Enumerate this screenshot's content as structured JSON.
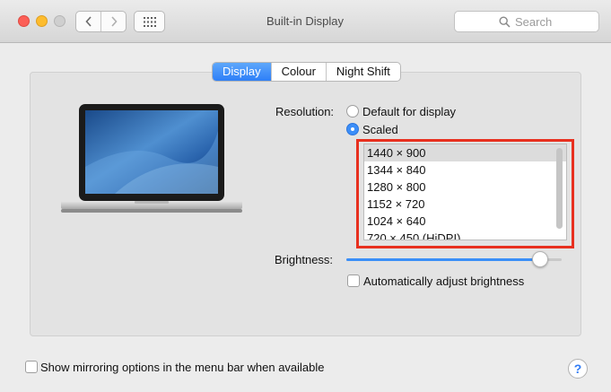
{
  "window": {
    "title": "Built-in Display"
  },
  "toolbar": {
    "back_icon": "chevron-left-icon",
    "forward_icon": "chevron-right-icon",
    "grid_icon": "grid-icon"
  },
  "search": {
    "placeholder": "Search",
    "value": ""
  },
  "tabs": [
    {
      "label": "Display",
      "active": true
    },
    {
      "label": "Colour",
      "active": false
    },
    {
      "label": "Night Shift",
      "active": false
    }
  ],
  "resolution": {
    "label": "Resolution:",
    "options": [
      {
        "label": "Default for display",
        "selected": false
      },
      {
        "label": "Scaled",
        "selected": true
      }
    ],
    "scaled_list": [
      {
        "label": "1440 × 900",
        "selected": true
      },
      {
        "label": "1344 × 840",
        "selected": false
      },
      {
        "label": "1280 × 800",
        "selected": false
      },
      {
        "label": "1152 × 720",
        "selected": false
      },
      {
        "label": "1024 × 640",
        "selected": false
      },
      {
        "label": "720 × 450 (HiDPI)",
        "selected": false
      }
    ]
  },
  "brightness": {
    "label": "Brightness:",
    "level": 0.9,
    "auto_label": "Automatically adjust brightness",
    "auto_checked": false
  },
  "mirroring": {
    "label": "Show mirroring options in the menu bar when available",
    "checked": false
  },
  "help": {
    "label": "?"
  },
  "colors": {
    "accent": "#3b8ff7",
    "highlight_border": "#e8301f"
  }
}
